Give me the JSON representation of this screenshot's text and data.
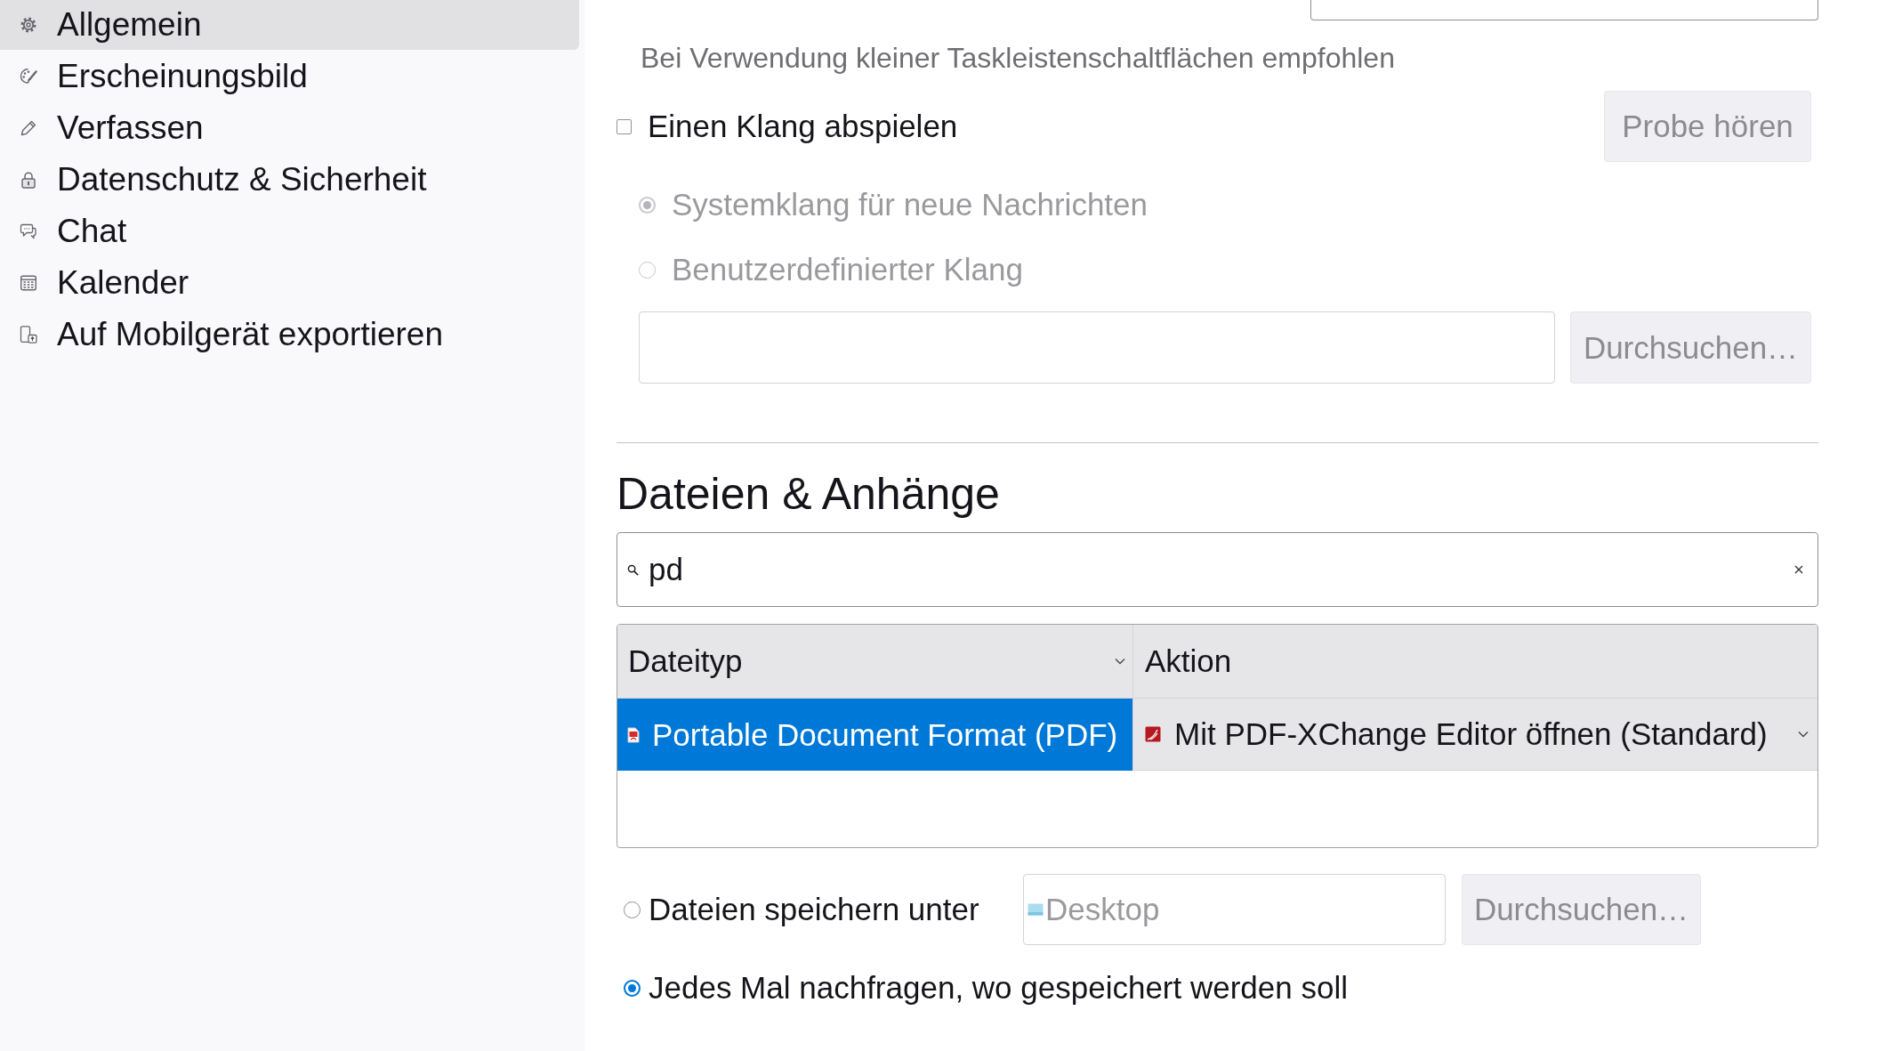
{
  "sidebar": {
    "items": [
      {
        "label": "Allgemein",
        "selected": true
      },
      {
        "label": "Erscheinungsbild",
        "selected": false
      },
      {
        "label": "Verfassen",
        "selected": false
      },
      {
        "label": "Datenschutz & Sicherheit",
        "selected": false
      },
      {
        "label": "Chat",
        "selected": false
      },
      {
        "label": "Kalender",
        "selected": false
      },
      {
        "label": "Auf Mobilgerät exportieren",
        "selected": false
      }
    ]
  },
  "hint": "Bei Verwendung kleiner Taskleistenschaltflächen empfohlen",
  "sound": {
    "play_sound": {
      "label": "Einen Klang abspielen",
      "checked": false
    },
    "preview_button": {
      "label": "Probe hören",
      "disabled": true
    },
    "options": [
      {
        "label": "Systemklang für neue Nachrichten",
        "selected": true,
        "disabled": true
      },
      {
        "label": "Benutzerdefinierter Klang",
        "selected": false,
        "disabled": true
      }
    ],
    "custom_file": {
      "disabled": true
    },
    "browse_button": {
      "label": "Durchsuchen…",
      "disabled": true
    }
  },
  "files": {
    "title": "Dateien & Anhänge",
    "search": {
      "value": "pd"
    },
    "table": {
      "columns": [
        {
          "label": "Dateityp",
          "sorted": true
        },
        {
          "label": "Aktion",
          "sorted": false
        }
      ],
      "rows": [
        {
          "type": "Portable Document Format (PDF)",
          "action": "Mit PDF-XChange Editor öffnen (Standard)",
          "selected": true
        }
      ]
    },
    "save_options": [
      {
        "kind": "folder",
        "label": "Dateien speichern unter",
        "selected": false,
        "folder": {
          "value": "Desktop",
          "disabled": true
        },
        "button": {
          "label": "Durchsuchen…",
          "disabled": true
        }
      },
      {
        "kind": "plain",
        "label": "Jedes Mal nachfragen, wo gespeichert werden soll",
        "selected": true
      }
    ]
  }
}
